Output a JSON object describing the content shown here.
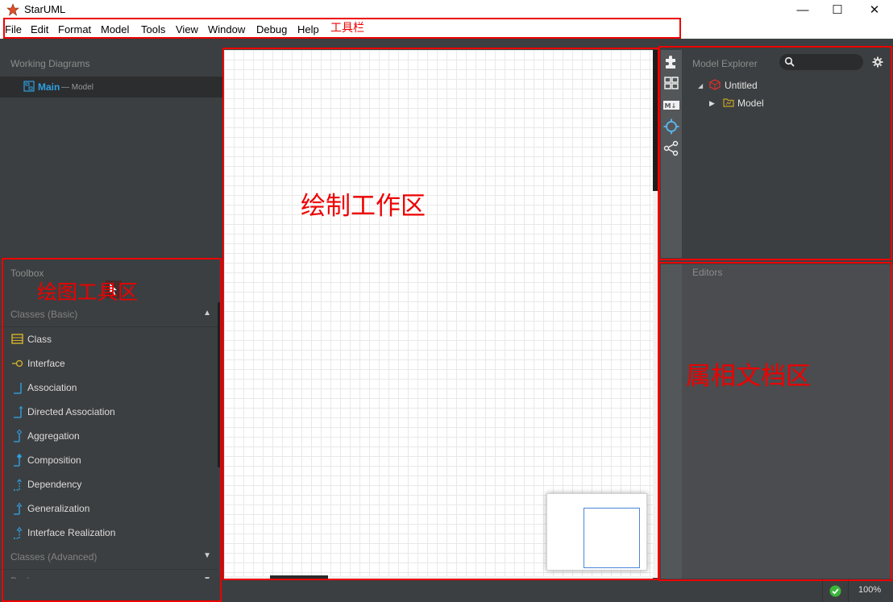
{
  "window": {
    "title": "StarUML",
    "minimize": "—",
    "maximize": "☐",
    "close": "✕"
  },
  "menubar": {
    "items": [
      "File",
      "Edit",
      "Format",
      "Model",
      "Tools",
      "View",
      "Window",
      "Debug",
      "Help"
    ]
  },
  "working_diagrams": {
    "heading": "Working Diagrams",
    "item_name": "Main",
    "item_sub": "— Model"
  },
  "toolbox": {
    "heading": "Toolbox",
    "sections": [
      {
        "label": "Classes (Basic)",
        "arrow": "▲"
      },
      {
        "label": "Classes (Advanced)",
        "arrow": "▼"
      },
      {
        "label": "Packages",
        "arrow": "▼"
      }
    ],
    "items": [
      "Class",
      "Interface",
      "Association",
      "Directed Association",
      "Aggregation",
      "Composition",
      "Dependency",
      "Generalization",
      "Interface Realization"
    ]
  },
  "explorer": {
    "heading": "Model Explorer",
    "search_icon": "search-icon",
    "root": "Untitled",
    "child": "Model"
  },
  "editors": {
    "heading": "Editors"
  },
  "statusbar": {
    "zoom": "100%"
  },
  "annotations": {
    "toolbar": "工具栏",
    "canvas": "绘制工作区",
    "toolbox": "绘图工具区",
    "properties": "属相文档区"
  },
  "colors": {
    "accent": "#2f9fe0",
    "annotation": "#e00000",
    "folder": "#c9a227",
    "ok": "#3ab53a"
  }
}
